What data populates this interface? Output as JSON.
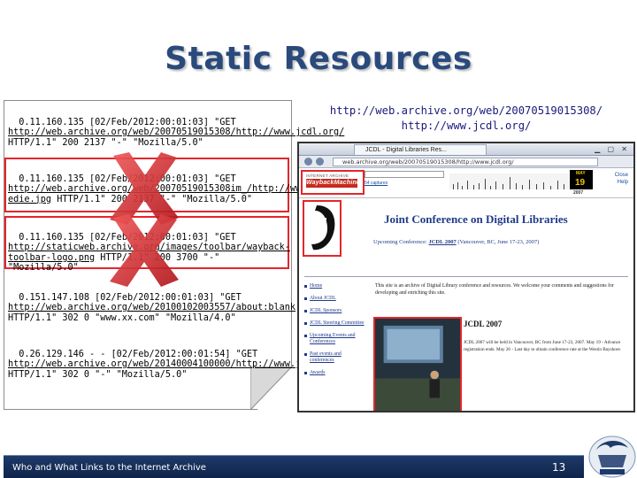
{
  "slide": {
    "title": "Static Resources",
    "footer_text": "Who and What Links to the Internet Archive",
    "page_number": "13"
  },
  "log": {
    "entries": [
      {
        "pre": "0.11.160.135 [02/Feb/2012:00:01:03] \"GET ",
        "link": "http://web.archive.org/web/20070519015308/http://www.jcdl.org/",
        "post": " HTTP/1.1\" 200 2137 \"-\" \"Mozilla/5.0\"",
        "crossed_out": false
      },
      {
        "pre": "0.11.160.135 [02/Feb/2012:00:01:03] \"GET ",
        "link": "http://web.archive.org/web/20070519015308im_/http://www.jcdl.org/images/jcdl2007-edie.jpg",
        "post": " HTTP/1.1\" 200 2137 \"-\" \"Mozilla/5.0\"",
        "crossed_out": true
      },
      {
        "pre": "0.11.160.135 [02/Feb/2012:00:01:03] \"GET ",
        "link": "http://staticweb.archive.org/images/toolbar/wayback-toolbar-logo.png",
        "post": " HTTP/1.1\" 200 3700 \"-\" \"Mozilla/5.0\"",
        "crossed_out": true
      },
      {
        "pre": "0.151.147.108 [02/Feb/2012:00:01:03] \"GET ",
        "link": "http://web.archive.org/web/20100102003557/about:blank",
        "post": " HTTP/1.1\" 302 0 \"www.xx.com\" \"Mozilla/4.0\"",
        "crossed_out": false
      },
      {
        "pre": "0.26.129.146 - - [02/Feb/2012:00:01:54] \"GET ",
        "link": "http://web.archive.org/web/20140004100000/http://www.jcdl.org/",
        "post": " HTTP/1.1\" 302 0 \"-\" \"Mozilla/5.0\"",
        "crossed_out": false
      }
    ]
  },
  "archive_url": {
    "line1": "http://web.archive.org/web/20070519015308/",
    "line2": "http://www.jcdl.org/"
  },
  "browser": {
    "tab_title": "JCDL - Digital Libraries Res...",
    "address": "web.archive.org/web/20070519015308/http://www.jcdl.org/",
    "wayback_top": "INTERNET ARCHIVE",
    "wayback_logo": "WaybackMachine",
    "wayback_captures": "54 captures",
    "calendar_month": "MAY",
    "calendar_day": "19",
    "calendar_year": "2007",
    "close_label": "Close",
    "help_label": "Help",
    "site_heading": "Joint Conference on Digital Libraries",
    "site_sub_pre": "Upcoming Conference: ",
    "site_sub_link": "JCDL 2007",
    "site_sub_post": " (Vancouver, BC, June 17-23, 2007)",
    "nav_items": [
      "Home",
      "About JCDL",
      "JCDL Sponsors",
      "JCDL Steering Committee",
      "Upcoming Events and Conferences",
      "Past events and conferences",
      "Awards"
    ],
    "blurb": "This site is an archive of Digital Library conference and resources. We welcome your comments and suggestions for developing and enriching this site.",
    "jcdl_title": "JCDL 2007",
    "jcdl_text": "JCDL 2007 will be held in Vancouver, BC from June 17-23, 2007. May 19 - Advance registration ends. May 26 - Last day to obtain conference rate at the Westin Bayshore."
  },
  "colors": {
    "title": "#2a4a7c",
    "red_marks": "#e3262c",
    "footer": "#1e3a6b",
    "link_text": "#1a1a7a"
  }
}
